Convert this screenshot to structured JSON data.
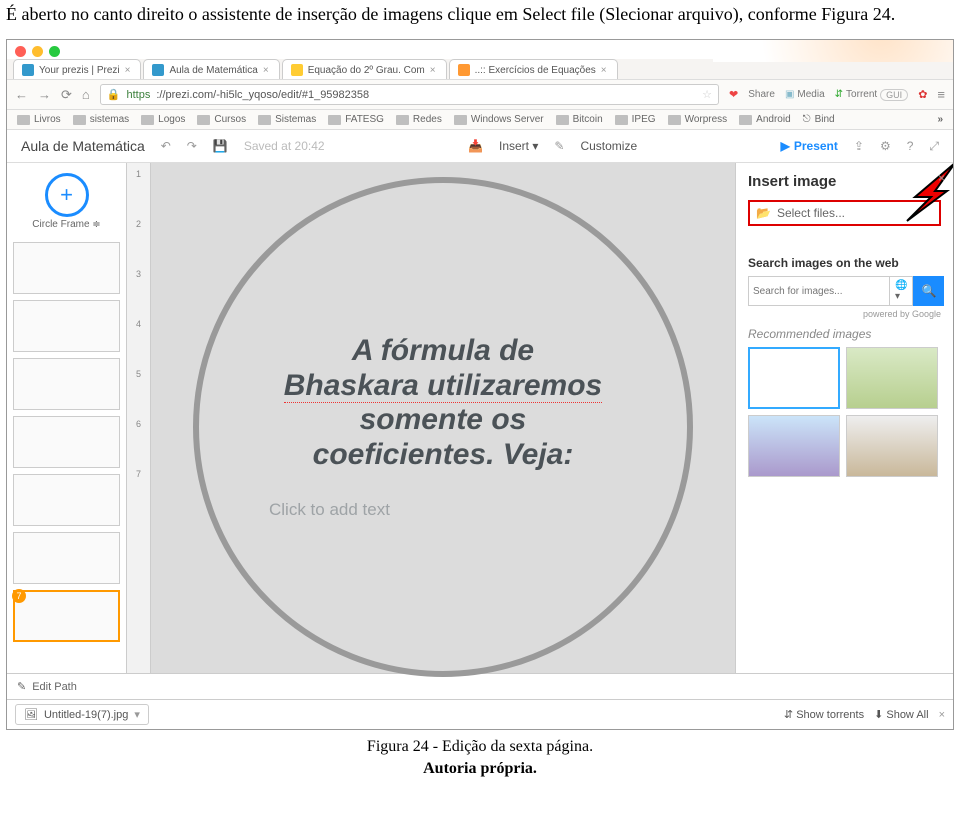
{
  "doc_intro": "É aberto no canto direito o assistente de inserção de imagens clique em Select file (Slecionar arquivo), conforme Figura 24.",
  "tabs": [
    "Your prezis | Prezi",
    "Aula de Matemática",
    "Equação do 2º Grau. Com",
    "..:: Exercícios de Equações"
  ],
  "address": {
    "scheme": "https",
    "rest": "://prezi.com/-hi5lc_yqoso/edit/#1_95982358"
  },
  "ext": {
    "share": "Share",
    "media": "Media",
    "torrent": "Torrent",
    "gui": "GUI"
  },
  "bookmarks": [
    "Livros",
    "sistemas",
    "Logos",
    "Cursos",
    "Sistemas",
    "FATESG",
    "Redes",
    "Windows Server",
    "Bitcoin",
    "IPEG",
    "Worpress",
    "Android",
    "Bind"
  ],
  "prezibar": {
    "title": "Aula de Matemática",
    "saved": "Saved at 20:42",
    "insert": "Insert",
    "customize": "Customize",
    "present": "Present"
  },
  "ribbon": {
    "circle_label": "Circle Frame"
  },
  "path_numbers": [
    "1",
    "2",
    "3",
    "4",
    "5",
    "6",
    "7"
  ],
  "path_badge": "7",
  "thumb_active_num": "7",
  "canvas": {
    "line1": "A fórmula de",
    "line2": "Bhaskara utilizaremos",
    "line3": "somente os",
    "line4": "coeficientes. Veja:",
    "placeholder": "Click to add text"
  },
  "rpanel": {
    "title": "Insert image",
    "select_files": "Select files...",
    "search_label": "Search images on the web",
    "search_placeholder": "Search for images...",
    "powered": "powered by Google",
    "recommended": "Recommended images"
  },
  "editpath": "Edit Path",
  "dl": {
    "file": "Untitled-19(7).jpg",
    "show_torrents": "Show torrents",
    "show_all": "Show All"
  },
  "caption": "Figura 24 - Edição da sexta página.",
  "caption2": "Autoria própria."
}
